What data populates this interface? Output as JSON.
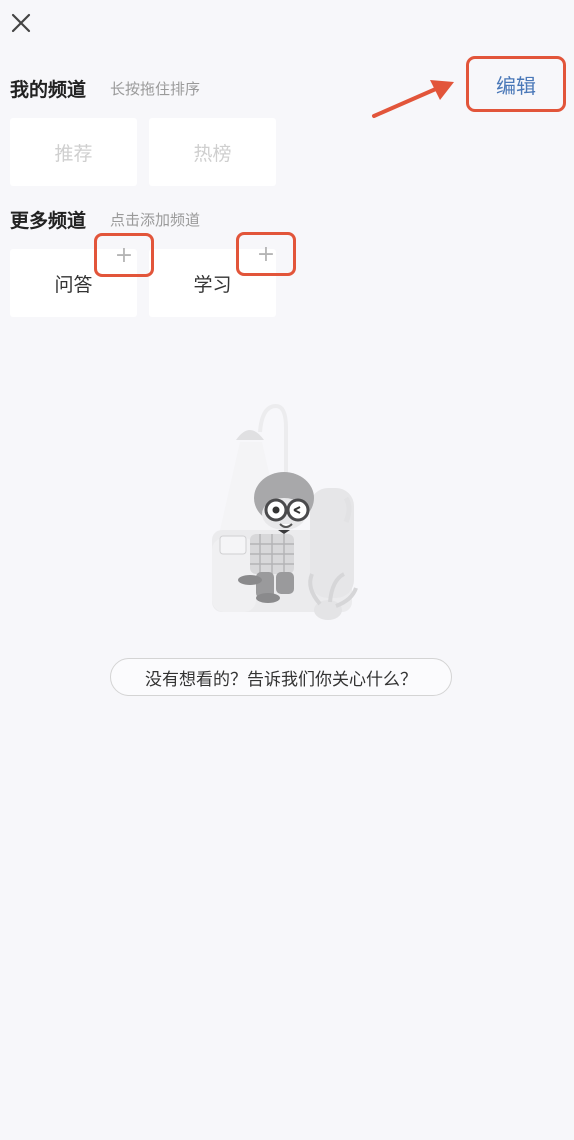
{
  "header": {
    "close_icon": "close-icon"
  },
  "my_channels": {
    "title": "我的频道",
    "hint": "长按拖住排序",
    "edit_label": "编辑",
    "items": [
      {
        "label": "推荐"
      },
      {
        "label": "热榜"
      }
    ]
  },
  "more_channels": {
    "title": "更多频道",
    "hint": "点击添加频道",
    "items": [
      {
        "label": "问答",
        "add_icon": "+"
      },
      {
        "label": "学习",
        "add_icon": "+"
      }
    ]
  },
  "empty_state": {
    "feedback_label": "没有想看的？告诉我们你关心什么？"
  },
  "colors": {
    "background": "#f7f7fa",
    "accent_blue": "#4a78b8",
    "annotation_red": "#e2553a"
  }
}
